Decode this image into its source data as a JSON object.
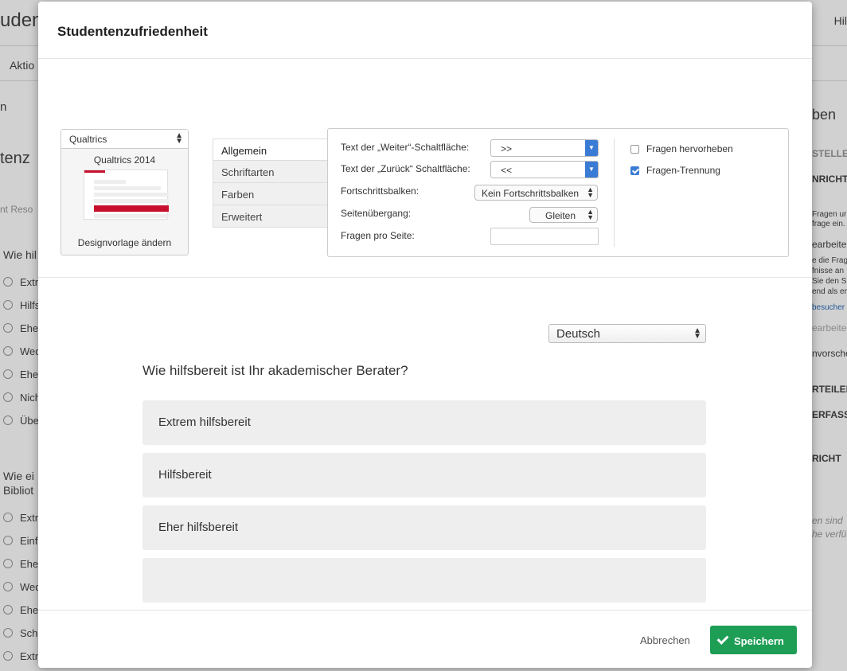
{
  "background": {
    "title_fragment": "udent",
    "help_fragment": "Hil",
    "menu_fragment": "Aktio",
    "left_fragments": [
      "n",
      "tenz",
      "nt Reso",
      "Wie hil",
      "Wie ei",
      "Bibliot"
    ],
    "left_options_1": [
      "Extr",
      "Hilfs",
      "Ehe",
      "Wed",
      "Ehe",
      "Nich",
      "Übe"
    ],
    "left_options_2": [
      "Extr",
      "Einf",
      "Ehe",
      "Wed",
      "Ehe",
      "Sch",
      "Extr"
    ],
    "right_fragments": [
      "ben",
      "STELLEN",
      "NRICHT",
      "Fragen ur",
      "frage ein.",
      "earbeite",
      "e die Frag",
      "fnisse an",
      "Sie den S",
      "end als eri",
      "besucher",
      "earbeite",
      "nvorsche",
      "RTEILEN",
      "ERFASS",
      "RICHT",
      "en sind",
      "he verfü"
    ]
  },
  "modal": {
    "title": "Studentenzufriedenheit",
    "theme": {
      "selector_label": "Qualtrics",
      "name": "Qualtrics 2014",
      "change_label": "Designvorlage ändern"
    },
    "tabs": [
      "Allgemein",
      "Schriftarten",
      "Farben",
      "Erweitert"
    ],
    "general": {
      "next_label": "Text der „Weiter“-Schaltfläche:",
      "next_value": ">>",
      "back_label": "Text der „Zurück“ Schaltfläche:",
      "back_value": "<<",
      "progress_label": "Fortschrittsbalken:",
      "progress_value": "Kein Fortschrittsbalken",
      "transition_label": "Seitenübergang:",
      "transition_value": "Gleiten",
      "per_page_label": "Fragen pro Seite:",
      "per_page_value": ""
    },
    "options": {
      "highlight_label": "Fragen hervorheben",
      "highlight_checked": false,
      "separator_label": "Fragen-Trennung",
      "separator_checked": true
    },
    "preview": {
      "language": "Deutsch",
      "question": "Wie hilfsbereit ist Ihr akademischer Berater?",
      "choices": [
        "Extrem hilfsbereit",
        "Hilfsbereit",
        "Eher hilfsbereit",
        ""
      ]
    },
    "footer": {
      "cancel_label": "Abbrechen",
      "save_label": "Speichern"
    }
  },
  "colors": {
    "accent_blue": "#3a7bd5",
    "save_green": "#1e9e55",
    "brand_red": "#c8102e"
  }
}
